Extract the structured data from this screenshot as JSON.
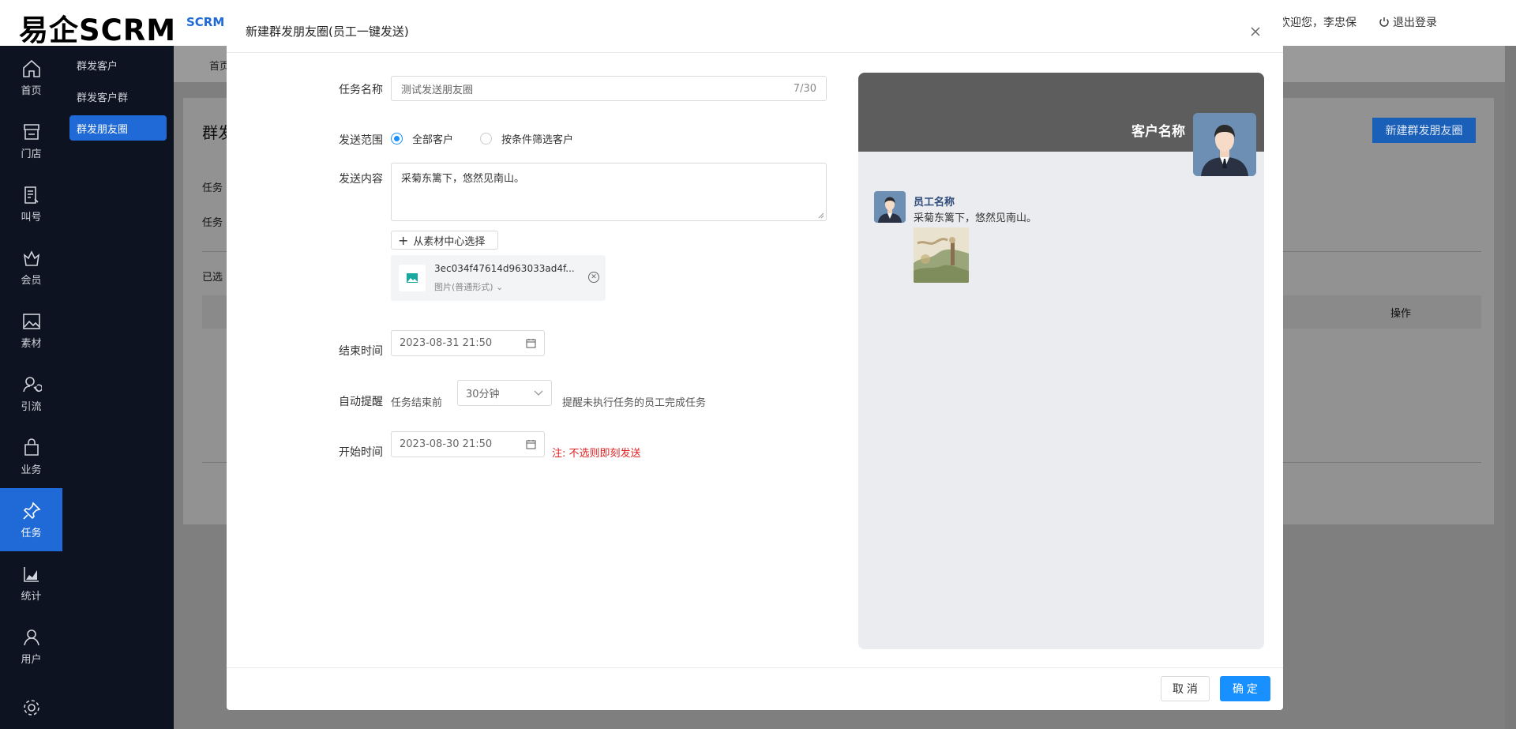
{
  "app": {
    "logo": "易企SCRM",
    "brand_tag": "SCRM",
    "welcome": "欢迎您，李忠保",
    "logout": "退出登录"
  },
  "sidebar": {
    "items": [
      {
        "label": "首页",
        "icon": "home-icon"
      },
      {
        "label": "门店",
        "icon": "store-icon"
      },
      {
        "label": "叫号",
        "icon": "queue-icon"
      },
      {
        "label": "会员",
        "icon": "member-icon"
      },
      {
        "label": "素材",
        "icon": "image-icon"
      },
      {
        "label": "引流",
        "icon": "traffic-icon"
      },
      {
        "label": "业务",
        "icon": "bag-icon"
      },
      {
        "label": "任务",
        "icon": "pin-icon",
        "active": true
      },
      {
        "label": "统计",
        "icon": "chart-icon"
      },
      {
        "label": "用户",
        "icon": "user-icon"
      },
      {
        "label": "",
        "icon": "gear-icon"
      }
    ]
  },
  "subnav": {
    "items": [
      {
        "label": "群发客户"
      },
      {
        "label": "群发客户群"
      },
      {
        "label": "群发朋友圈",
        "active": true
      }
    ]
  },
  "background": {
    "crumb": "首页",
    "page_title": "群发",
    "new_button": "新建群发朋友圈",
    "row1_label": "任务",
    "row2_label": "任务",
    "selected_label": "已选",
    "op_header": "操作"
  },
  "modal": {
    "title": "新建群发朋友圈(员工一键发送)",
    "task_name": {
      "label": "任务名称",
      "value": "测试发送朋友圈",
      "counter": "7/30"
    },
    "scope": {
      "label": "发送范围",
      "options": [
        "全部客户",
        "按条件筛选客户"
      ],
      "selected": "全部客户"
    },
    "content": {
      "label": "发送内容",
      "value": "采菊东篱下，悠然见南山。"
    },
    "material_button": "从素材中心选择",
    "attachment": {
      "filename": "3ec034f47614d963033ad4f...",
      "type": "图片(普通形式)"
    },
    "end_time": {
      "label": "结束时间",
      "value": "2023-08-31 21:50"
    },
    "reminder": {
      "label": "自动提醒",
      "prefix": "任务结束前",
      "value": "30分钟",
      "suffix": "提醒未执行任务的员工完成任务"
    },
    "start_time": {
      "label": "开始时间",
      "value": "2023-08-30 21:50",
      "note": "注: 不选则即刻发送"
    },
    "preview": {
      "customer_name": "客户名称",
      "employee_name": "员工名称",
      "message": "采菊东篱下，悠然见南山。"
    },
    "cancel_label": "取 消",
    "ok_label": "确 定"
  },
  "colors": {
    "accent": "#1890ff",
    "nav_bg": "#0d1321",
    "nav_active": "#1f6ad6",
    "warning": "#e02020"
  }
}
